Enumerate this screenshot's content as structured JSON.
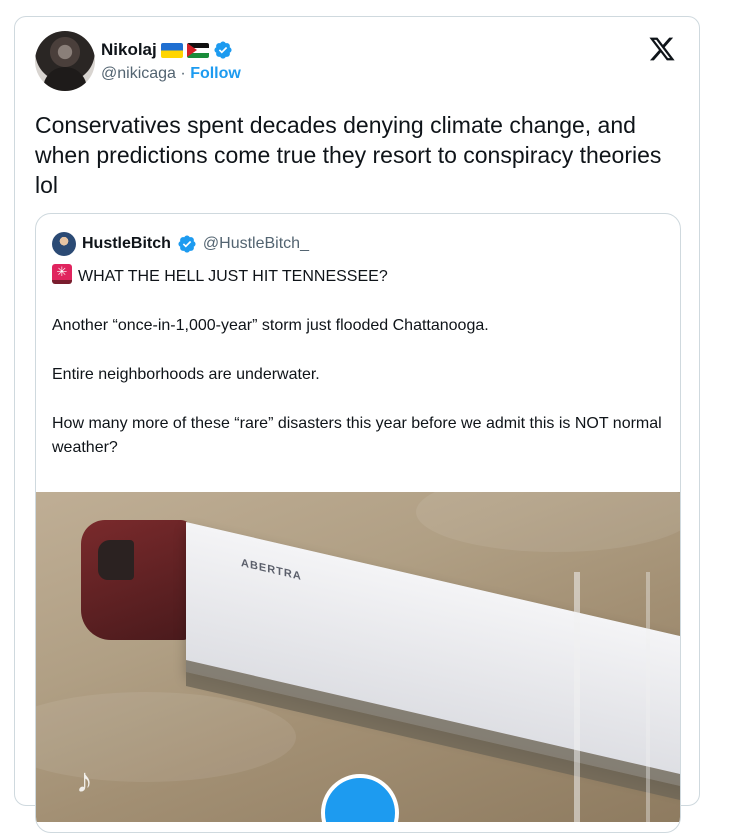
{
  "author": {
    "name": "Nikolaj",
    "handle": "@nikicaga",
    "separator": "·",
    "follow_label": "Follow",
    "flags": [
      "ukraine-flag-icon",
      "palestine-flag-icon"
    ],
    "verified": true
  },
  "tweet": {
    "text": "Conservatives spent decades denying climate change, and when predictions come true they resort to conspiracy theories lol"
  },
  "quote": {
    "name": "HustleBitch",
    "handle": "@HustleBitch_",
    "verified": true,
    "headline": "WHAT THE HELL JUST HIT TENNESSEE?",
    "paragraphs": [
      "Another “once-in-1,000-year” storm just flooded Chattanooga.",
      "Entire neighborhoods are underwater.",
      "How many more of these “rare” disasters this year before we admit this is NOT normal weather?"
    ],
    "media": {
      "type": "video",
      "trailer_logo_text": "ABERTRA"
    }
  },
  "colors": {
    "accent": "#1d9bf0",
    "text": "#0f1419",
    "secondary": "#536471",
    "border": "#cfd9de"
  }
}
